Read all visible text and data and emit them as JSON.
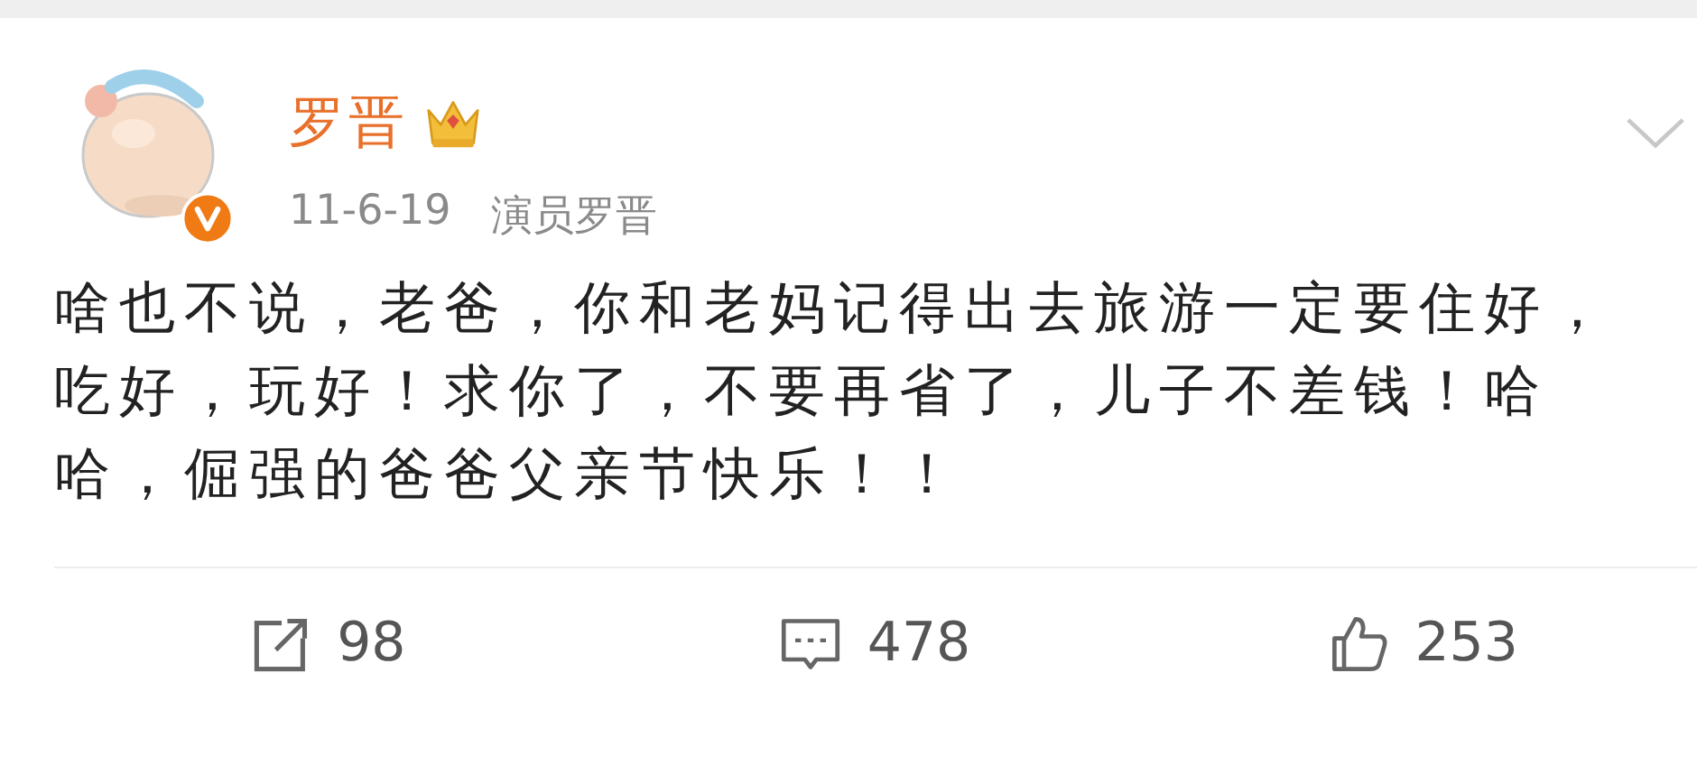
{
  "post": {
    "author": "罗晋",
    "time": "11-6-19",
    "source": "演员罗晋",
    "text": "啥也不说，老爸，你和老妈记得出去旅游一定要住好，吃好，玩好！求你了，不要再省了，儿子不差钱！哈哈，倔强的爸爸父亲节快乐！！"
  },
  "actions": [
    {
      "kind": "repost",
      "count": "98"
    },
    {
      "kind": "comment",
      "count": "478"
    },
    {
      "kind": "like",
      "count": "253"
    }
  ]
}
